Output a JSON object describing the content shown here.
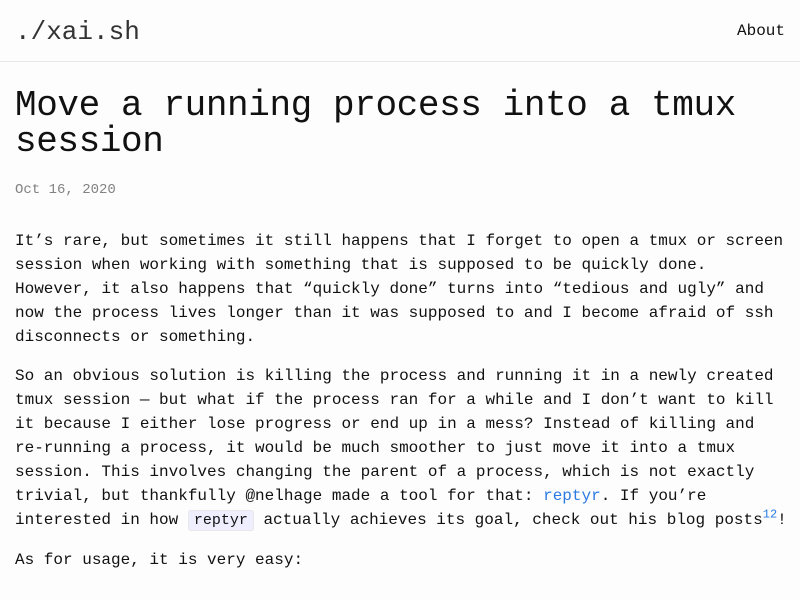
{
  "header": {
    "site_title": "./xai.sh",
    "nav": {
      "about_label": "About"
    }
  },
  "post": {
    "title": "Move a running process into a tmux session",
    "date": "Oct 16, 2020",
    "paragraphs": {
      "p1": "It’s rare, but sometimes it still happens that I forget to open a tmux or screen session when working with something that is supposed to be quickly done. However, it also happens that “quickly done” turns into “tedious and ugly” and now the process lives longer than it was supposed to and I become afraid of ssh disconnects or something.",
      "p2_part1": "So an obvious solution is killing the process and running it in a newly created tmux session — but what if the process ran for a while and I don’t want to kill it because I either lose progress or end up in a mess? Instead of killing and re-running a process, it would be much smoother to just move it into a tmux session. This involves changing the parent of a process, which is not exactly trivial, but thankfully @nelhage made a tool for that: ",
      "p2_link": "reptyr",
      "p2_part2": ". If you’re interested in how ",
      "p2_code": "reptyr",
      "p2_part3": " actually achieves its goal, check out his blog posts",
      "p2_footnote_1": "1",
      "p2_footnote_2": "2",
      "p2_part4": "!",
      "p3": "As for usage, it is very easy:"
    }
  }
}
